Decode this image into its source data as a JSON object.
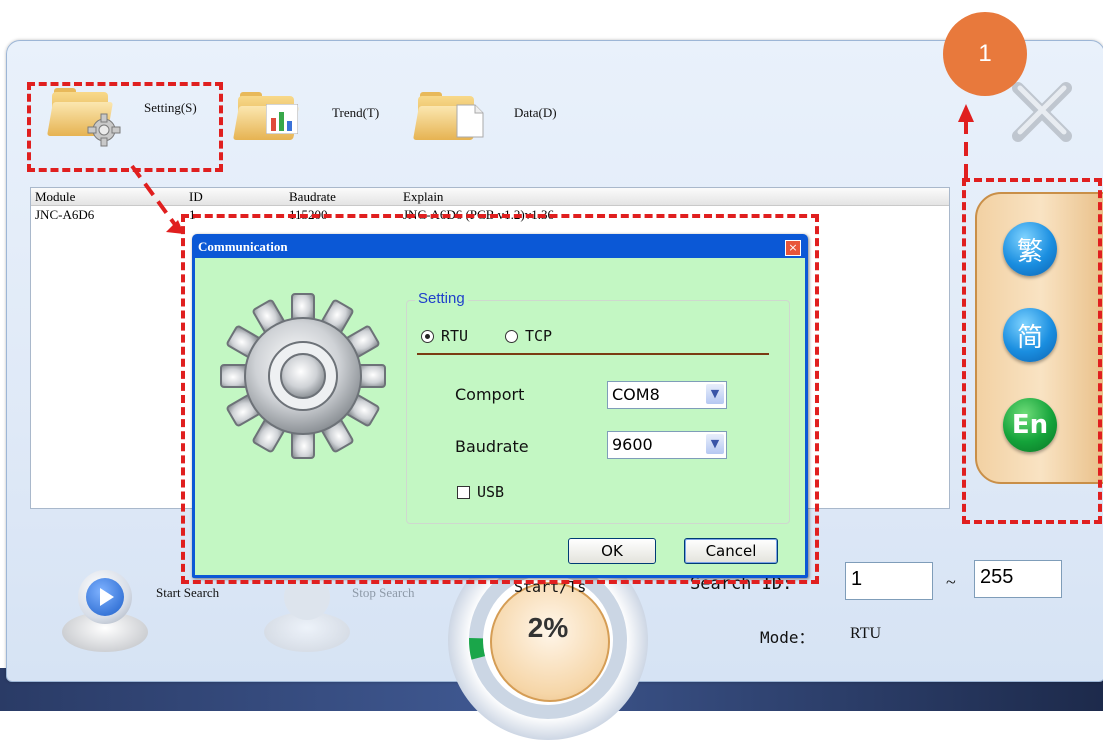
{
  "toolbar": {
    "setting_label": "Setting(S)",
    "trend_label": "Trend(T)",
    "data_label": "Data(D)"
  },
  "badge": "1",
  "list": {
    "headers": [
      "Module",
      "ID",
      "Baudrate",
      "Explain"
    ],
    "rows": [
      [
        "JNC-A6D6",
        "1",
        "115200",
        "JNC-A6D6 (PCB v1.2)v1.36"
      ]
    ]
  },
  "language": {
    "traditional": "繁",
    "simplified": "简",
    "english": "En"
  },
  "dialog": {
    "title": "Communication",
    "group_label": "Setting",
    "rtu_label": "RTU",
    "tcp_label": "TCP",
    "mode_selected": "RTU",
    "comport_label": "Comport",
    "comport_value": "COM8",
    "baudrate_label": "Baudrate",
    "baudrate_value": "9600",
    "usb_label": "USB",
    "usb_checked": false,
    "ok_label": "OK",
    "cancel_label": "Cancel"
  },
  "bottom": {
    "start_label": "Start Search",
    "stop_label": "Stop Search",
    "status_partial": "Start/Ts",
    "progress_text": "2%",
    "progress_value": 0.02,
    "range_label_partial": "Search ID:",
    "range_from": "1",
    "range_sep": "~",
    "range_to": "255",
    "mode_label": "Mode：",
    "mode_value": "RTU"
  },
  "colors": {
    "annotation_red": "#e01f1f",
    "badge_orange": "#e8793c",
    "dialog_title_blue": "#0b58d6",
    "dialog_body_green": "#c3f7c3"
  }
}
